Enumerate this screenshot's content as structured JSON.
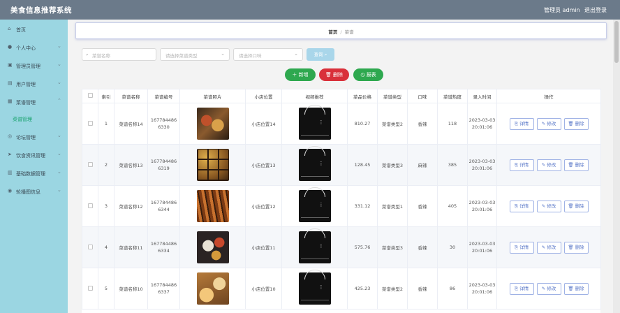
{
  "header": {
    "title": "美食信息推荐系统",
    "admin": "管理员 admin",
    "logout": "退出登录",
    "bg_color": "#6b7a8a"
  },
  "sidebar": {
    "bg_color": "#9bd6e2",
    "items": [
      {
        "label": "首页",
        "icon": "home-icon",
        "has_caret": false
      },
      {
        "label": "个人中心",
        "icon": "user-icon",
        "has_caret": true
      },
      {
        "label": "管理员管理",
        "icon": "admin-icon",
        "has_caret": true
      },
      {
        "label": "用户管理",
        "icon": "users-icon",
        "has_caret": true
      },
      {
        "label": "菜谱管理",
        "icon": "menu-icon",
        "has_caret": true
      },
      {
        "label": "论坛管理",
        "icon": "forum-icon",
        "has_caret": true
      },
      {
        "label": "饮食资讯管理",
        "icon": "news-icon",
        "has_caret": true
      },
      {
        "label": "基础数据管理",
        "icon": "data-icon",
        "has_caret": true
      },
      {
        "label": "轮播图信息",
        "icon": "carousel-icon",
        "has_caret": true
      }
    ],
    "active_sub": "菜谱管理"
  },
  "breadcrumb": {
    "home": "首页",
    "separator": "/",
    "current": "菜谱"
  },
  "search": {
    "name_placeholder": "菜谱名称",
    "type_placeholder": "请选择菜谱类型",
    "taste_placeholder": "请选择口味",
    "button_label": "查询 ⌕"
  },
  "actions": {
    "add": "＋ 新增",
    "delete": "🗑 删除",
    "report": "◷ 报表"
  },
  "table": {
    "columns": [
      "索引",
      "菜谱名称",
      "菜谱编号",
      "菜谱照片",
      "小店位置",
      "视频推荐",
      "菜品价格",
      "菜谱类型",
      "口味",
      "菜谱热度",
      "录入时间",
      "操作"
    ],
    "row_actions": {
      "detail": "⎘ 详情",
      "edit": "✎ 修改",
      "delete": "🗑 删除"
    },
    "rows": [
      {
        "index": "1",
        "name": "菜谱名称14",
        "code_a": "167784486",
        "code_b": "6330",
        "photo": "hotdog",
        "location": "小店位置14",
        "price": "810.27",
        "type": "菜谱类型2",
        "taste": "香辣",
        "heat": "118",
        "date": "2023-03-03",
        "time": "20:01:06"
      },
      {
        "index": "2",
        "name": "菜谱名称13",
        "code_a": "167784486",
        "code_b": "6319",
        "photo": "bento",
        "location": "小店位置13",
        "price": "128.45",
        "type": "菜谱类型3",
        "taste": "麻辣",
        "heat": "385",
        "date": "2023-03-03",
        "time": "20:01:06"
      },
      {
        "index": "3",
        "name": "菜谱名称12",
        "code_a": "167784486",
        "code_b": "6344",
        "photo": "skewers",
        "location": "小店位置12",
        "price": "331.12",
        "type": "菜谱类型1",
        "taste": "香辣",
        "heat": "405",
        "date": "2023-03-03",
        "time": "20:01:06"
      },
      {
        "index": "4",
        "name": "菜谱名称11",
        "code_a": "167784486",
        "code_b": "6334",
        "photo": "platter",
        "location": "小店位置11",
        "price": "575.76",
        "type": "菜谱类型3",
        "taste": "香辣",
        "heat": "30",
        "date": "2023-03-03",
        "time": "20:01:06"
      },
      {
        "index": "5",
        "name": "菜谱名称10",
        "code_a": "167784486",
        "code_b": "6337",
        "photo": "cakes",
        "location": "小店位置10",
        "price": "425.23",
        "type": "菜谱类型2",
        "taste": "香辣",
        "heat": "86",
        "date": "2023-03-03",
        "time": "20:01:06"
      }
    ]
  }
}
